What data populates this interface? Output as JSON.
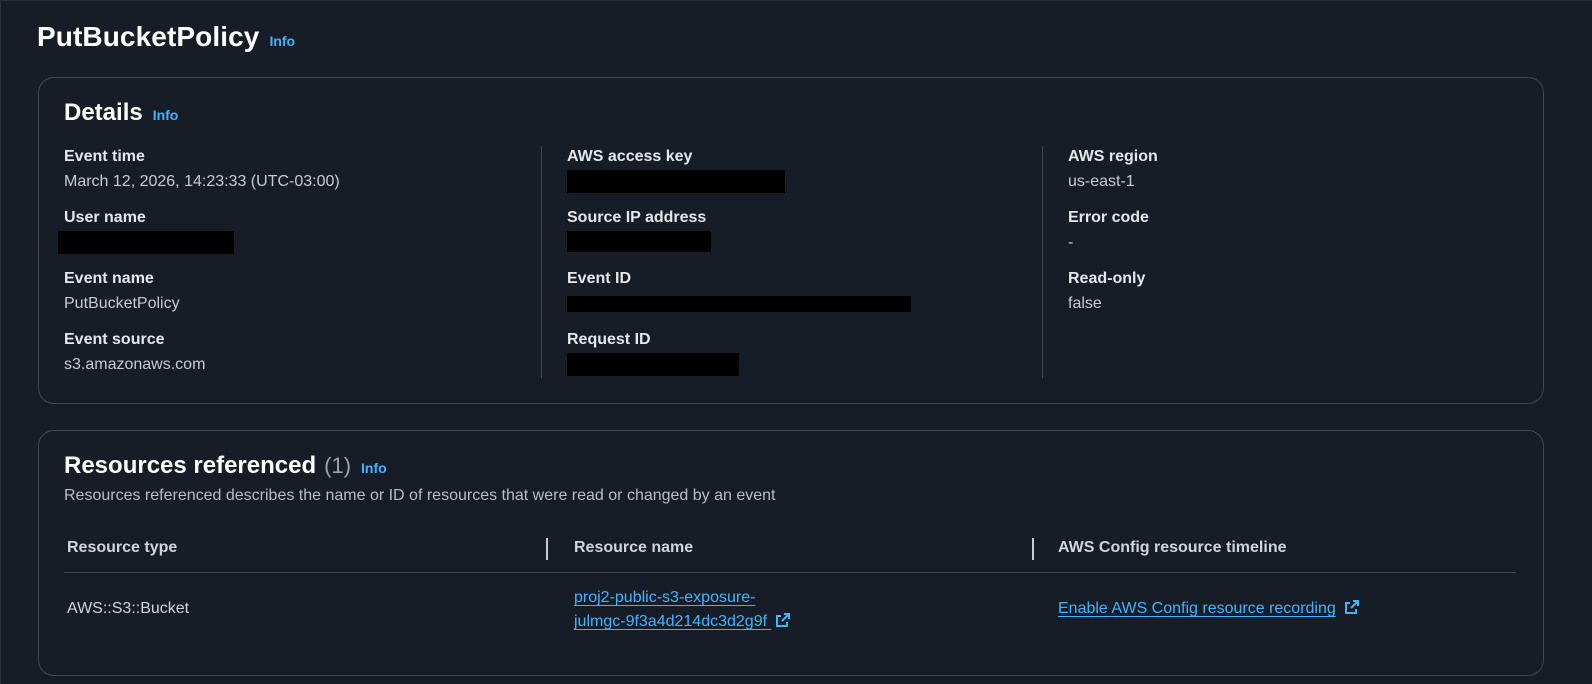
{
  "page": {
    "title": "PutBucketPolicy",
    "info_label": "Info"
  },
  "details": {
    "title": "Details",
    "info_label": "Info",
    "column1": [
      {
        "label": "Event time",
        "value": "March 12, 2026, 14:23:33 (UTC-03:00)",
        "redacted": false
      },
      {
        "label": "User name",
        "value": "",
        "redacted": true
      },
      {
        "label": "Event name",
        "value": "PutBucketPolicy",
        "redacted": false
      },
      {
        "label": "Event source",
        "value": "s3.amazonaws.com",
        "redacted": false
      }
    ],
    "column2": [
      {
        "label": "AWS access key",
        "value": "",
        "redacted": true
      },
      {
        "label": "Source IP address",
        "value": "",
        "redacted": true
      },
      {
        "label": "Event ID",
        "value": "",
        "redacted": true
      },
      {
        "label": "Request ID",
        "value": "",
        "redacted": true
      }
    ],
    "column3": [
      {
        "label": "AWS region",
        "value": "us-east-1",
        "redacted": false
      },
      {
        "label": "Error code",
        "value": "-",
        "redacted": false
      },
      {
        "label": "Read-only",
        "value": "false",
        "redacted": false
      }
    ]
  },
  "resources": {
    "title": "Resources referenced",
    "count": "(1)",
    "info_label": "Info",
    "description": "Resources referenced describes the name or ID of resources that were read or changed by an event",
    "columns": [
      "Resource type",
      "Resource name",
      "AWS Config resource timeline"
    ],
    "rows": [
      {
        "type": "AWS::S3::Bucket",
        "name_line1": "proj2-public-s3-exposure-",
        "name_line2": "julmgc-9f3a4d214dc3d2g9f",
        "timeline": "Enable AWS Config resource recording"
      }
    ]
  },
  "colors": {
    "background": "#161d26",
    "link": "#42b4ff",
    "border": "#424650"
  },
  "icons": {
    "external_link": "external-link-icon"
  }
}
